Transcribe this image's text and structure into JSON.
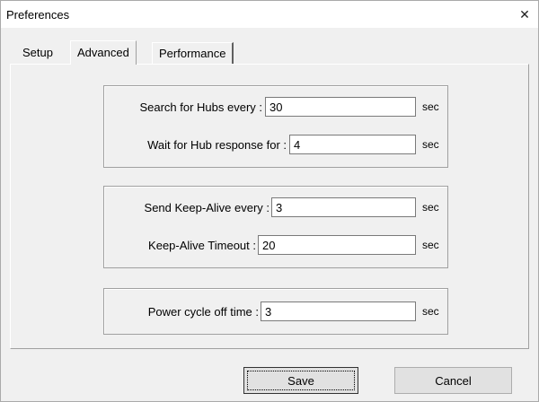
{
  "window": {
    "title": "Preferences",
    "close_glyph": "✕"
  },
  "tabs": [
    {
      "label": "Setup",
      "selected": false
    },
    {
      "label": "Advanced",
      "selected": true
    },
    {
      "label": "Performance",
      "selected": false
    }
  ],
  "hubs": {
    "search_label": "Search for Hubs every :",
    "search_value": "30",
    "search_unit": "sec",
    "wait_label": "Wait for Hub response for :",
    "wait_value": "4",
    "wait_unit": "sec"
  },
  "keepalive": {
    "send_label": "Send Keep-Alive every :",
    "send_value": "3",
    "send_unit": "sec",
    "timeout_label": "Keep-Alive Timeout :",
    "timeout_value": "20",
    "timeout_unit": "sec"
  },
  "power": {
    "label": "Power cycle off time :",
    "value": "3",
    "unit": "sec"
  },
  "buttons": {
    "save": "Save",
    "cancel": "Cancel"
  }
}
